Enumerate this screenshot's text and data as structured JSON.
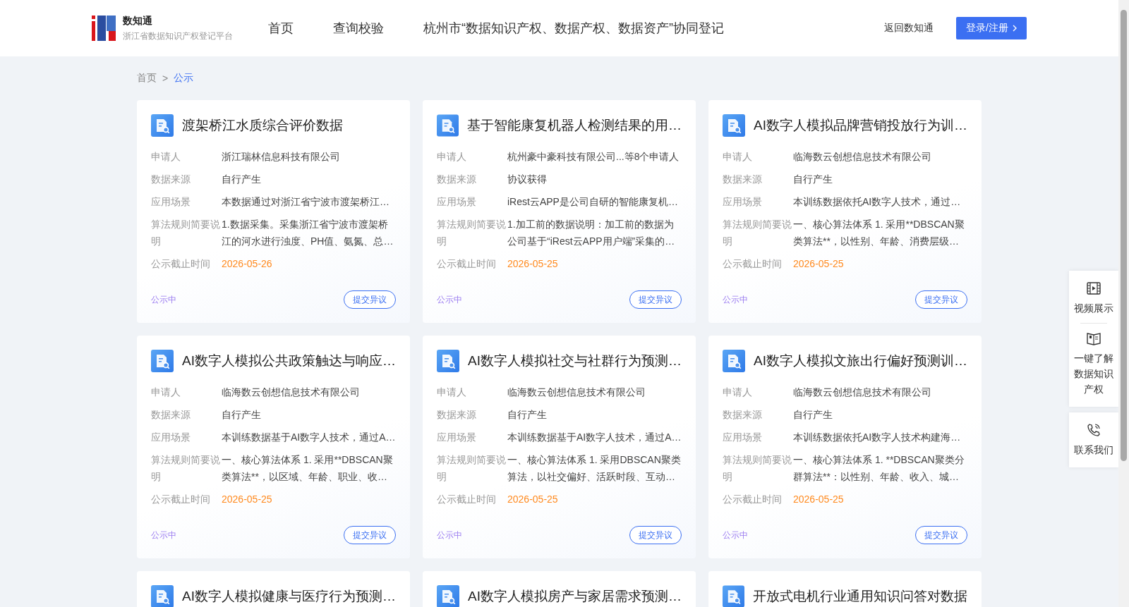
{
  "header": {
    "brand": {
      "name": "数知通",
      "subtitle": "浙江省数据知识产权登记平台"
    },
    "nav": [
      "首页",
      "查询校验",
      "杭州市“数据知识产权、数据产权、数据资产”协同登记"
    ],
    "back_link": "返回数知通",
    "login_button": "登录/注册"
  },
  "breadcrumb": [
    {
      "label": "首页",
      "selected": false
    },
    {
      "label": "公示",
      "selected": true
    }
  ],
  "separator": ">",
  "cards": [
    {
      "title": "渡架桥江水质综合评价数据",
      "fields": [
        {
          "label": "申请人",
          "value": "浙江瑞林信息科技有限公司"
        },
        {
          "label": "数据来源",
          "value": "自行产生"
        },
        {
          "label": "应用场景",
          "value": "本数据通过对浙江省宁波市渡架桥江…"
        },
        {
          "label": "算法规则简要说明",
          "value": "1.数据采集。采集浙江省宁波市渡架桥江的河水进行浊度、PH值、氨氮、总…"
        },
        {
          "label": "公示截止时间",
          "value": "2026-05-26",
          "kind": "date"
        }
      ],
      "status": "公示中",
      "action": "提交异议"
    },
    {
      "title": "基于智能康复机器人检测结果的用…",
      "fields": [
        {
          "label": "申请人",
          "value": "杭州豪中豪科技有限公司...等8个申请人"
        },
        {
          "label": "数据来源",
          "value": "协议获得"
        },
        {
          "label": "应用场景",
          "value": "iRest云APP是公司自研的智能康复机…"
        },
        {
          "label": "算法规则简要说明",
          "value": "1.加工前的数据说明：加工前的数据为公司基于“iRest云APP用户端”采集的…"
        },
        {
          "label": "公示截止时间",
          "value": "2026-05-25",
          "kind": "date"
        }
      ],
      "status": "公示中",
      "action": "提交异议"
    },
    {
      "title": "AI数字人模拟品牌营销投放行为训…",
      "fields": [
        {
          "label": "申请人",
          "value": "临海数云创想信息技术有限公司"
        },
        {
          "label": "数据来源",
          "value": "自行产生"
        },
        {
          "label": "应用场景",
          "value": "本训练数据依托AI数字人技术，通过…"
        },
        {
          "label": "算法规则简要说明",
          "value": "一、核心算法体系 1. 采用**DBSCAN聚类算法**，以性别、年龄、消费层级…"
        },
        {
          "label": "公示截止时间",
          "value": "2026-05-25",
          "kind": "date"
        }
      ],
      "status": "公示中",
      "action": "提交异议"
    },
    {
      "title": "AI数字人模拟公共政策触达与响应…",
      "fields": [
        {
          "label": "申请人",
          "value": "临海数云创想信息技术有限公司"
        },
        {
          "label": "数据来源",
          "value": "自行产生"
        },
        {
          "label": "应用场景",
          "value": "本训练数据基于AI数字人技术，通过A…"
        },
        {
          "label": "算法规则简要说明",
          "value": "一、核心算法体系 1. 采用**DBSCAN聚类算法**，以区域、年龄、职业、收…"
        },
        {
          "label": "公示截止时间",
          "value": "2026-05-25",
          "kind": "date"
        }
      ],
      "status": "公示中",
      "action": "提交异议"
    },
    {
      "title": "AI数字人模拟社交与社群行为预测…",
      "fields": [
        {
          "label": "申请人",
          "value": "临海数云创想信息技术有限公司"
        },
        {
          "label": "数据来源",
          "value": "自行产生"
        },
        {
          "label": "应用场景",
          "value": "本训练数据基于AI数字人技术，通过A…"
        },
        {
          "label": "算法规则简要说明",
          "value": "一、核心算法体系 1. 采用DBSCAN聚类算法，以社交偏好、活跃时段、互动…"
        },
        {
          "label": "公示截止时间",
          "value": "2026-05-25",
          "kind": "date"
        }
      ],
      "status": "公示中",
      "action": "提交异议"
    },
    {
      "title": "AI数字人模拟文旅出行偏好预测训…",
      "fields": [
        {
          "label": "申请人",
          "value": "临海数云创想信息技术有限公司"
        },
        {
          "label": "数据来源",
          "value": "自行产生"
        },
        {
          "label": "应用场景",
          "value": "本训练数据依托AI数字人技术构建海…"
        },
        {
          "label": "算法规则简要说明",
          "value": "一、核心算法体系 1. **DBSCAN聚类分群算法**：以性别、年龄、收入、城…"
        },
        {
          "label": "公示截止时间",
          "value": "2026-05-25",
          "kind": "date"
        }
      ],
      "status": "公示中",
      "action": "提交异议"
    },
    {
      "title": "AI数字人模拟健康与医疗行为预测…"
    },
    {
      "title": "AI数字人模拟房产与家居需求预测…"
    },
    {
      "title": "开放式电机行业通用知识问答对数据"
    }
  ],
  "side_panel": [
    "视频展示",
    "一键了解数据知识产权",
    "联系我们"
  ]
}
